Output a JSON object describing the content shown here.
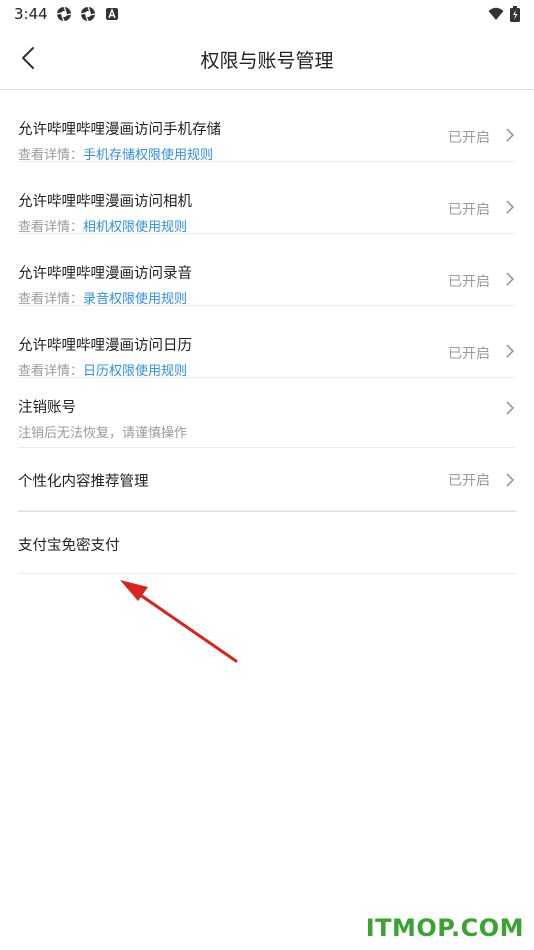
{
  "status": {
    "time": "3:44",
    "icons": [
      "aperture-icon",
      "aperture-icon",
      "notification-a-icon"
    ],
    "right_icons": [
      "wifi-icon",
      "battery-icon"
    ]
  },
  "header": {
    "title": "权限与账号管理",
    "back_icon": "back-chevron-icon"
  },
  "items": [
    {
      "title": "允许哔哩哔哩漫画访问手机存储",
      "sub_prefix": "查看详情：",
      "sub_link": "手机存储权限使用规则",
      "status": "已开启"
    },
    {
      "title": "允许哔哩哔哩漫画访问相机",
      "sub_prefix": "查看详情：",
      "sub_link": "相机权限使用规则",
      "status": "已开启"
    },
    {
      "title": "允许哔哩哔哩漫画访问录音",
      "sub_prefix": "查看详情：",
      "sub_link": "录音权限使用规则",
      "status": "已开启"
    },
    {
      "title": "允许哔哩哔哩漫画访问日历",
      "sub_prefix": "查看详情：",
      "sub_link": "日历权限使用规则",
      "status": "已开启"
    },
    {
      "title": "注销账号",
      "sub_text": "注销后无法恢复，请谨慎操作"
    },
    {
      "title": "个性化内容推荐管理",
      "status": "已开启"
    },
    {
      "title": "支付宝免密支付"
    }
  ],
  "watermark": "ITMOP.COM",
  "colors": {
    "link": "#2f8fe6",
    "annotation_arrow": "#d9231f",
    "watermark": "#3aa334"
  }
}
